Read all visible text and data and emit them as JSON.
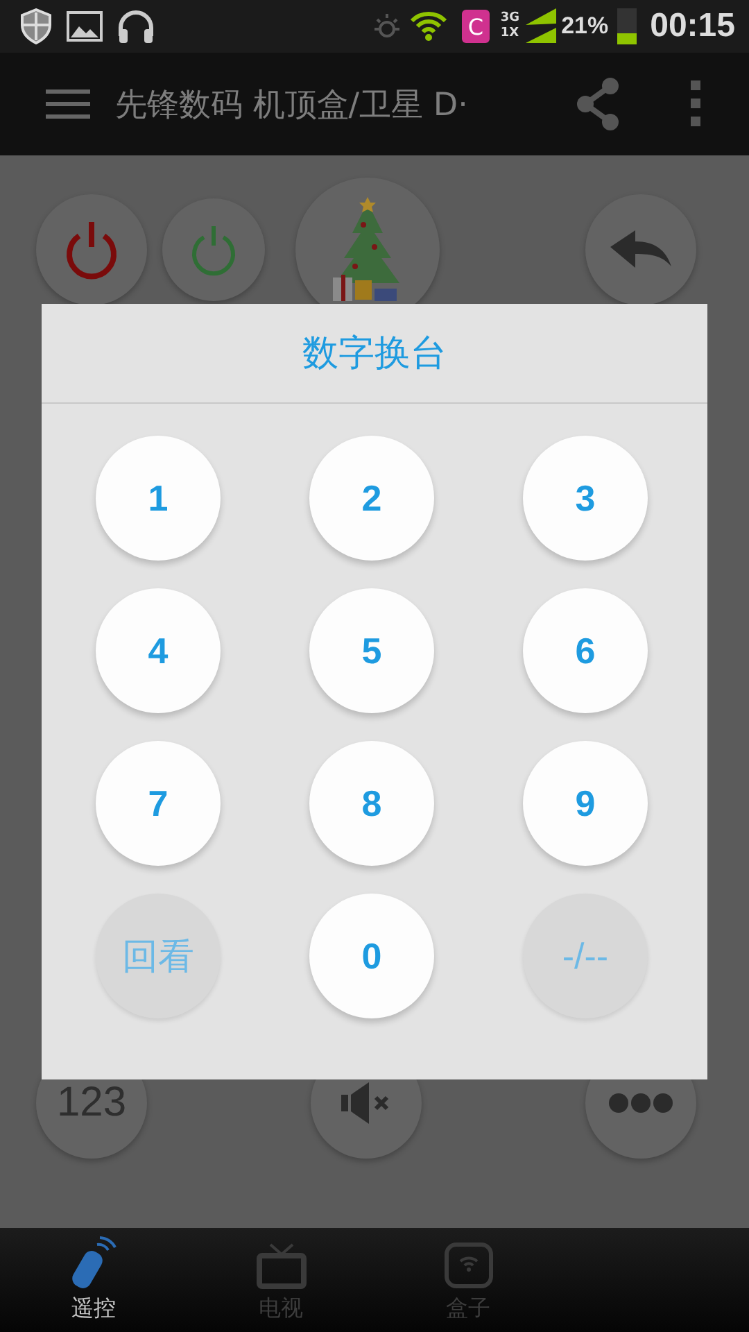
{
  "status_bar": {
    "app_badge": "C",
    "network_top": "3G",
    "network_bottom": "1X",
    "battery": "21%",
    "time": "00:15"
  },
  "action_bar": {
    "title": "先锋数码 机顶盒/卫星 D·"
  },
  "remote": {
    "bottom_left_label": "123"
  },
  "dialog": {
    "title": "数字换台",
    "keys": [
      {
        "label": "1",
        "kind": "digit"
      },
      {
        "label": "2",
        "kind": "digit"
      },
      {
        "label": "3",
        "kind": "digit"
      },
      {
        "label": "4",
        "kind": "digit"
      },
      {
        "label": "5",
        "kind": "digit"
      },
      {
        "label": "6",
        "kind": "digit"
      },
      {
        "label": "7",
        "kind": "digit"
      },
      {
        "label": "8",
        "kind": "digit"
      },
      {
        "label": "9",
        "kind": "digit"
      },
      {
        "label": "回看",
        "kind": "function"
      },
      {
        "label": "0",
        "kind": "digit"
      },
      {
        "label": "-/--",
        "kind": "function"
      }
    ]
  },
  "tabs": [
    {
      "label": "遥控",
      "kind": "remote",
      "selected": true
    },
    {
      "label": "电视",
      "kind": "tv",
      "selected": false
    },
    {
      "label": "盒子",
      "kind": "box",
      "selected": false
    }
  ]
}
